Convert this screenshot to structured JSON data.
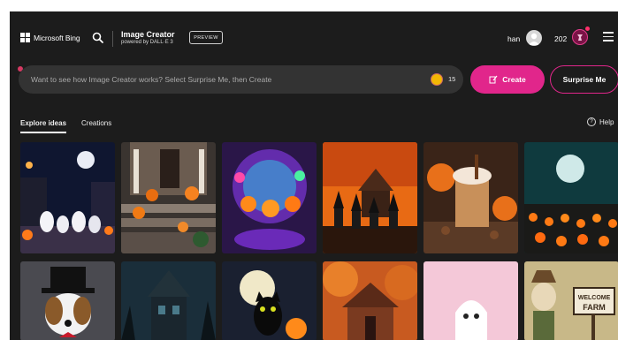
{
  "header": {
    "brand": "Microsoft Bing",
    "app_title": "Image Creator",
    "app_subtitle": "powered by DALL·E 3",
    "badge": "PREVIEW",
    "user_name": "han",
    "coins": "202"
  },
  "prompt": {
    "placeholder": "Want to see how Image Creator works? Select Surprise Me, then Create",
    "boosts": "15",
    "create_label": "Create",
    "surprise_label": "Surprise Me"
  },
  "tabs": {
    "explore": "Explore ideas",
    "creations": "Creations",
    "help": "Help"
  },
  "gallery_text": {
    "sign_line1": "WELCOME",
    "sign_line2": "FARM"
  },
  "colors": {
    "accent": "#e1268b",
    "background": "#1c1c1c",
    "input_bg": "#333333"
  },
  "icons": [
    "search-icon",
    "menu-icon",
    "create-icon",
    "rewards-icon",
    "boost-icon",
    "help-icon"
  ]
}
